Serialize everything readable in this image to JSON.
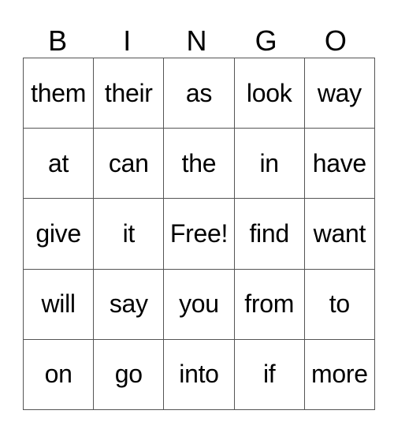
{
  "card": {
    "header": [
      "B",
      "I",
      "N",
      "G",
      "O"
    ],
    "rows": [
      [
        "them",
        "their",
        "as",
        "look",
        "way"
      ],
      [
        "at",
        "can",
        "the",
        "in",
        "have"
      ],
      [
        "give",
        "it",
        "Free!",
        "find",
        "want"
      ],
      [
        "will",
        "say",
        "you",
        "from",
        "to"
      ],
      [
        "on",
        "go",
        "into",
        "if",
        "more"
      ]
    ]
  }
}
